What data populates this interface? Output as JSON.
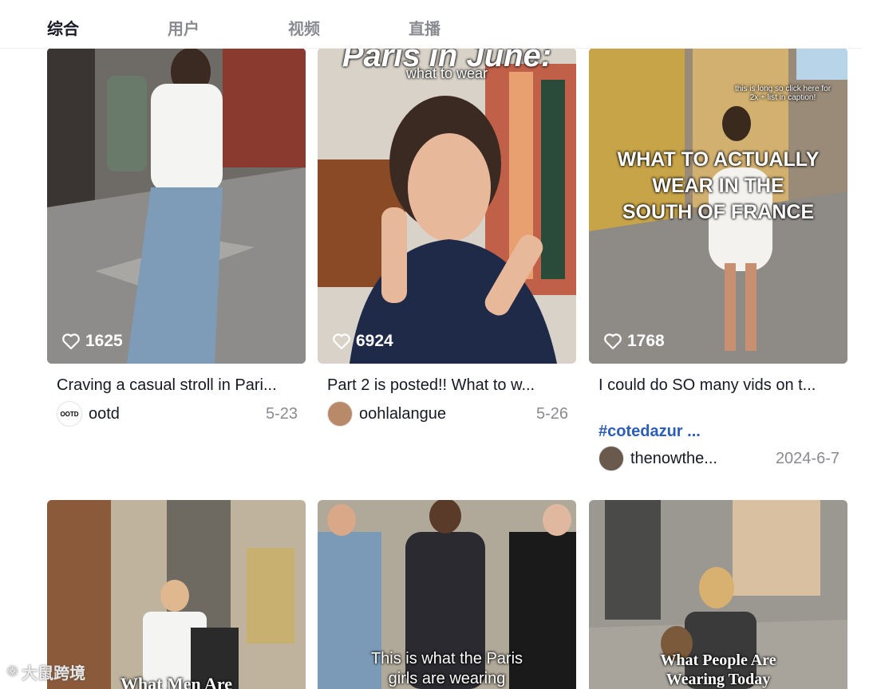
{
  "tabs": [
    {
      "label": "综合"
    },
    {
      "label": "用户"
    },
    {
      "label": "视频"
    },
    {
      "label": "直播"
    }
  ],
  "videos": [
    {
      "likes": "1625",
      "description": "Craving a casual stroll in Pari...",
      "author": "ootd",
      "avatar_text": "OOTD",
      "date": "5-23"
    },
    {
      "likes": "6924",
      "overlay_title": "Paris in June:",
      "overlay_sub": "what to wear",
      "description": "Part 2 is posted!! What to w...",
      "author": "oohlalangue",
      "date": "5-26"
    },
    {
      "likes": "1768",
      "overlay_small": "this is long so click here for 2x + list in caption!",
      "overlay_line1": "WHAT TO ACTUALLY",
      "overlay_line2": "WEAR IN THE",
      "overlay_line3": "SOUTH OF FRANCE",
      "description": "I could do SO many vids on t...",
      "hashtag": "#cotedazur ...",
      "author": "thenowthe...",
      "date": "2024-6-7"
    },
    {
      "overlay_title": "What Men Are"
    },
    {
      "overlay_line1": "This is what the Paris",
      "overlay_line2": "girls are wearing"
    },
    {
      "overlay_line1": "What People Are",
      "overlay_line2": "Wearing Today"
    }
  ],
  "watermark": "大鼠跨境"
}
